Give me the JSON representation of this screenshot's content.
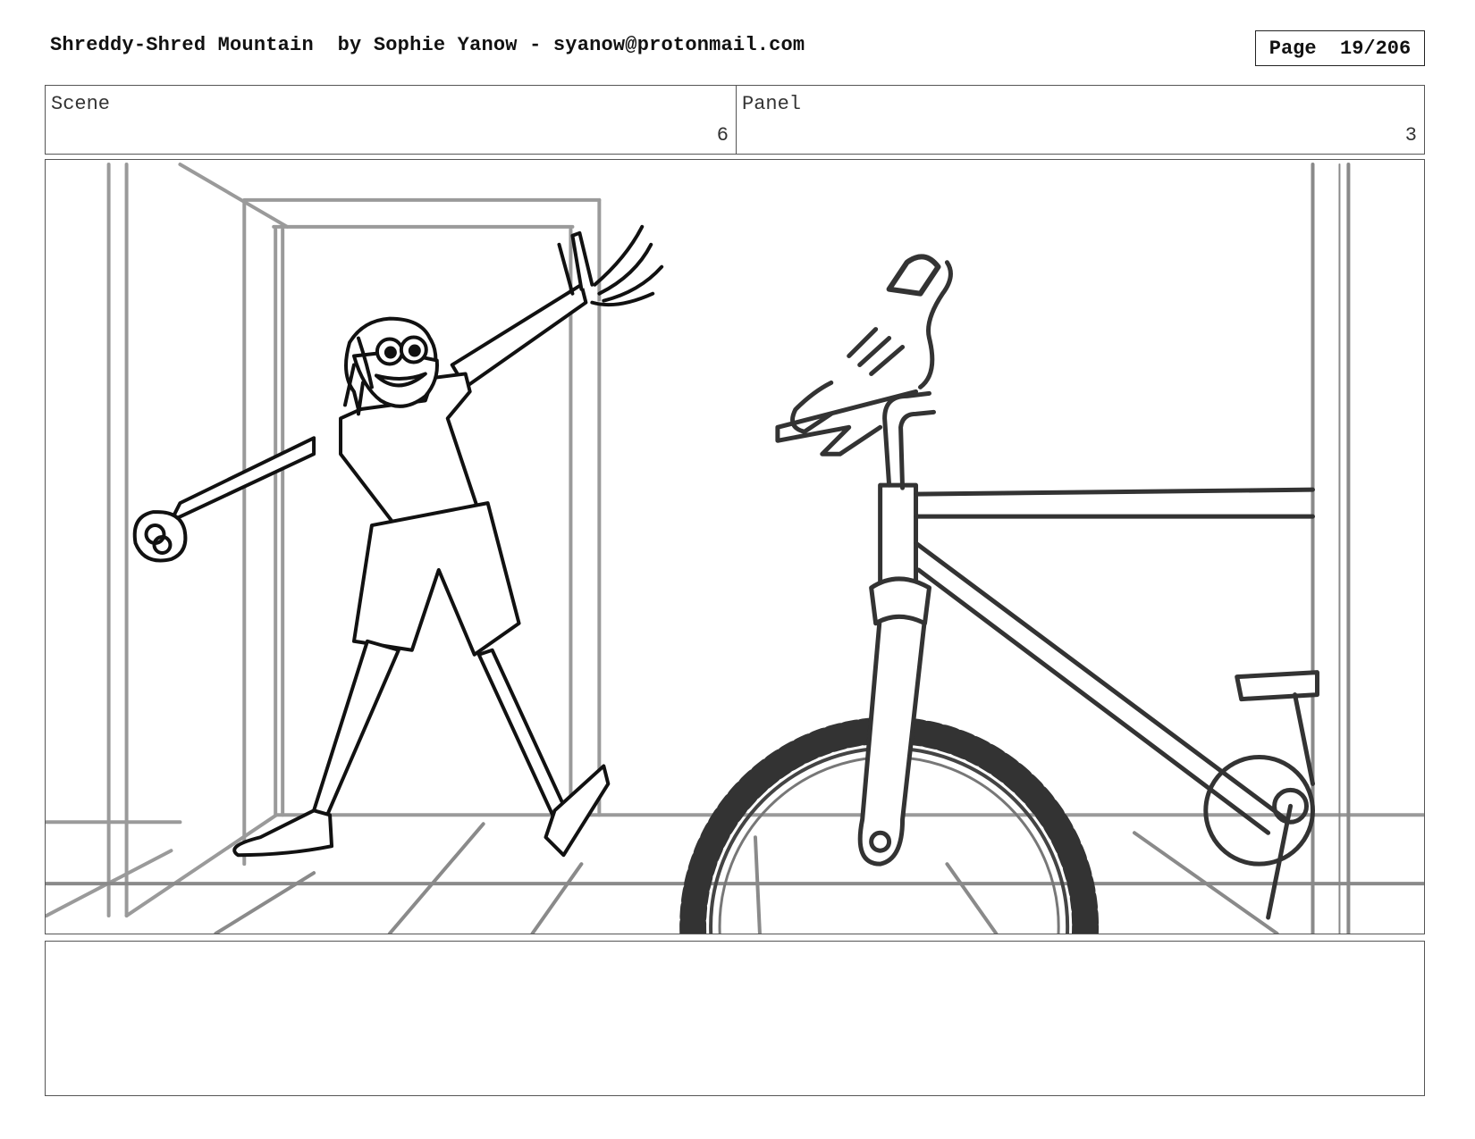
{
  "header": {
    "title": "Shreddy-Shred Mountain  by Sophie Yanow - syanow@protonmail.com",
    "page_label": "Page",
    "page_value": "19/206"
  },
  "scene": {
    "label": "Scene",
    "value": "6"
  },
  "panel": {
    "label": "Panel",
    "value": "3"
  },
  "notes": {
    "text": ""
  },
  "colors": {
    "border": "#555555",
    "sketch": "#111111",
    "background_lines": "#999999",
    "bike_lines": "#444444"
  }
}
